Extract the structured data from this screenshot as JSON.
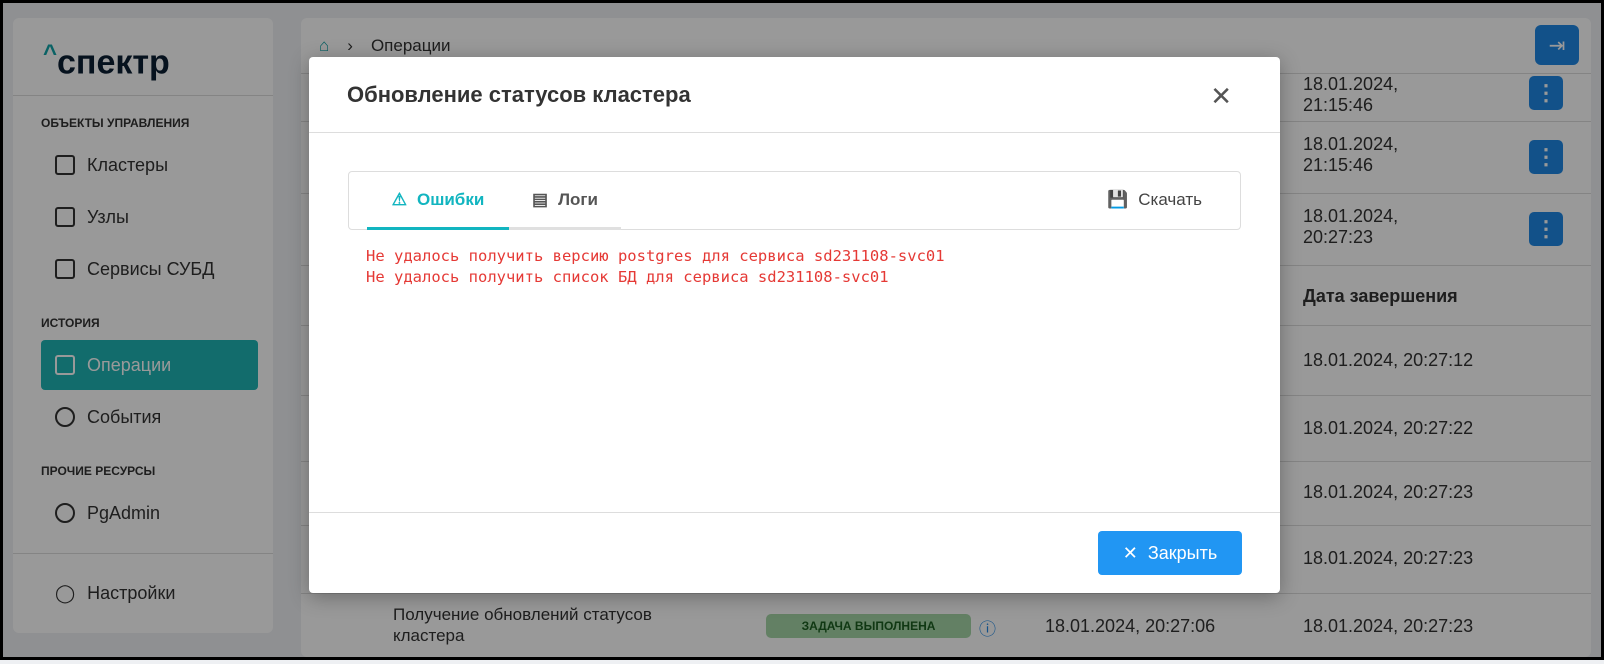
{
  "logo": "спектр",
  "sidebar": {
    "sections": [
      {
        "title": "ОБЪЕКТЫ УПРАВЛЕНИЯ",
        "items": [
          "Кластеры",
          "Узлы",
          "Сервисы СУБД"
        ]
      },
      {
        "title": "ИСТОРИЯ",
        "items": [
          "Операции",
          "События"
        ]
      },
      {
        "title": "ПРОЧИЕ РЕСУРСЫ",
        "items": [
          "PgAdmin"
        ]
      }
    ],
    "settings": "Настройки"
  },
  "breadcrumb": {
    "current": "Операции"
  },
  "table": {
    "header_end_date": "Дата завершения",
    "top_rows": [
      "18.01.2024,\n21:15:46",
      "18.01.2024,\n21:15:46",
      "18.01.2024,\n20:27:23"
    ],
    "end_dates": [
      "18.01.2024, 20:27:12",
      "18.01.2024, 20:27:22",
      "18.01.2024, 20:27:23",
      "18.01.2024, 20:27:23",
      "18.01.2024, 20:27:23"
    ],
    "last_row": {
      "name": "Получение обновлений статусов кластера",
      "status": "ЗАДАЧА ВЫПОЛНЕНА",
      "start": "18.01.2024, 20:27:06"
    }
  },
  "modal": {
    "title": "Обновление статусов кластера",
    "tabs": [
      "Ошибки",
      "Логи"
    ],
    "download": "Скачать",
    "errors": [
      "Не удалось получить версию postgres для сервиса sd231108-svc01",
      "Не удалось получить список БД для сервиса sd231108-svc01"
    ],
    "close": "Закрыть"
  },
  "colors": {
    "accent": "#12b5c0",
    "primary": "#2196f3",
    "error": "#e53935"
  }
}
